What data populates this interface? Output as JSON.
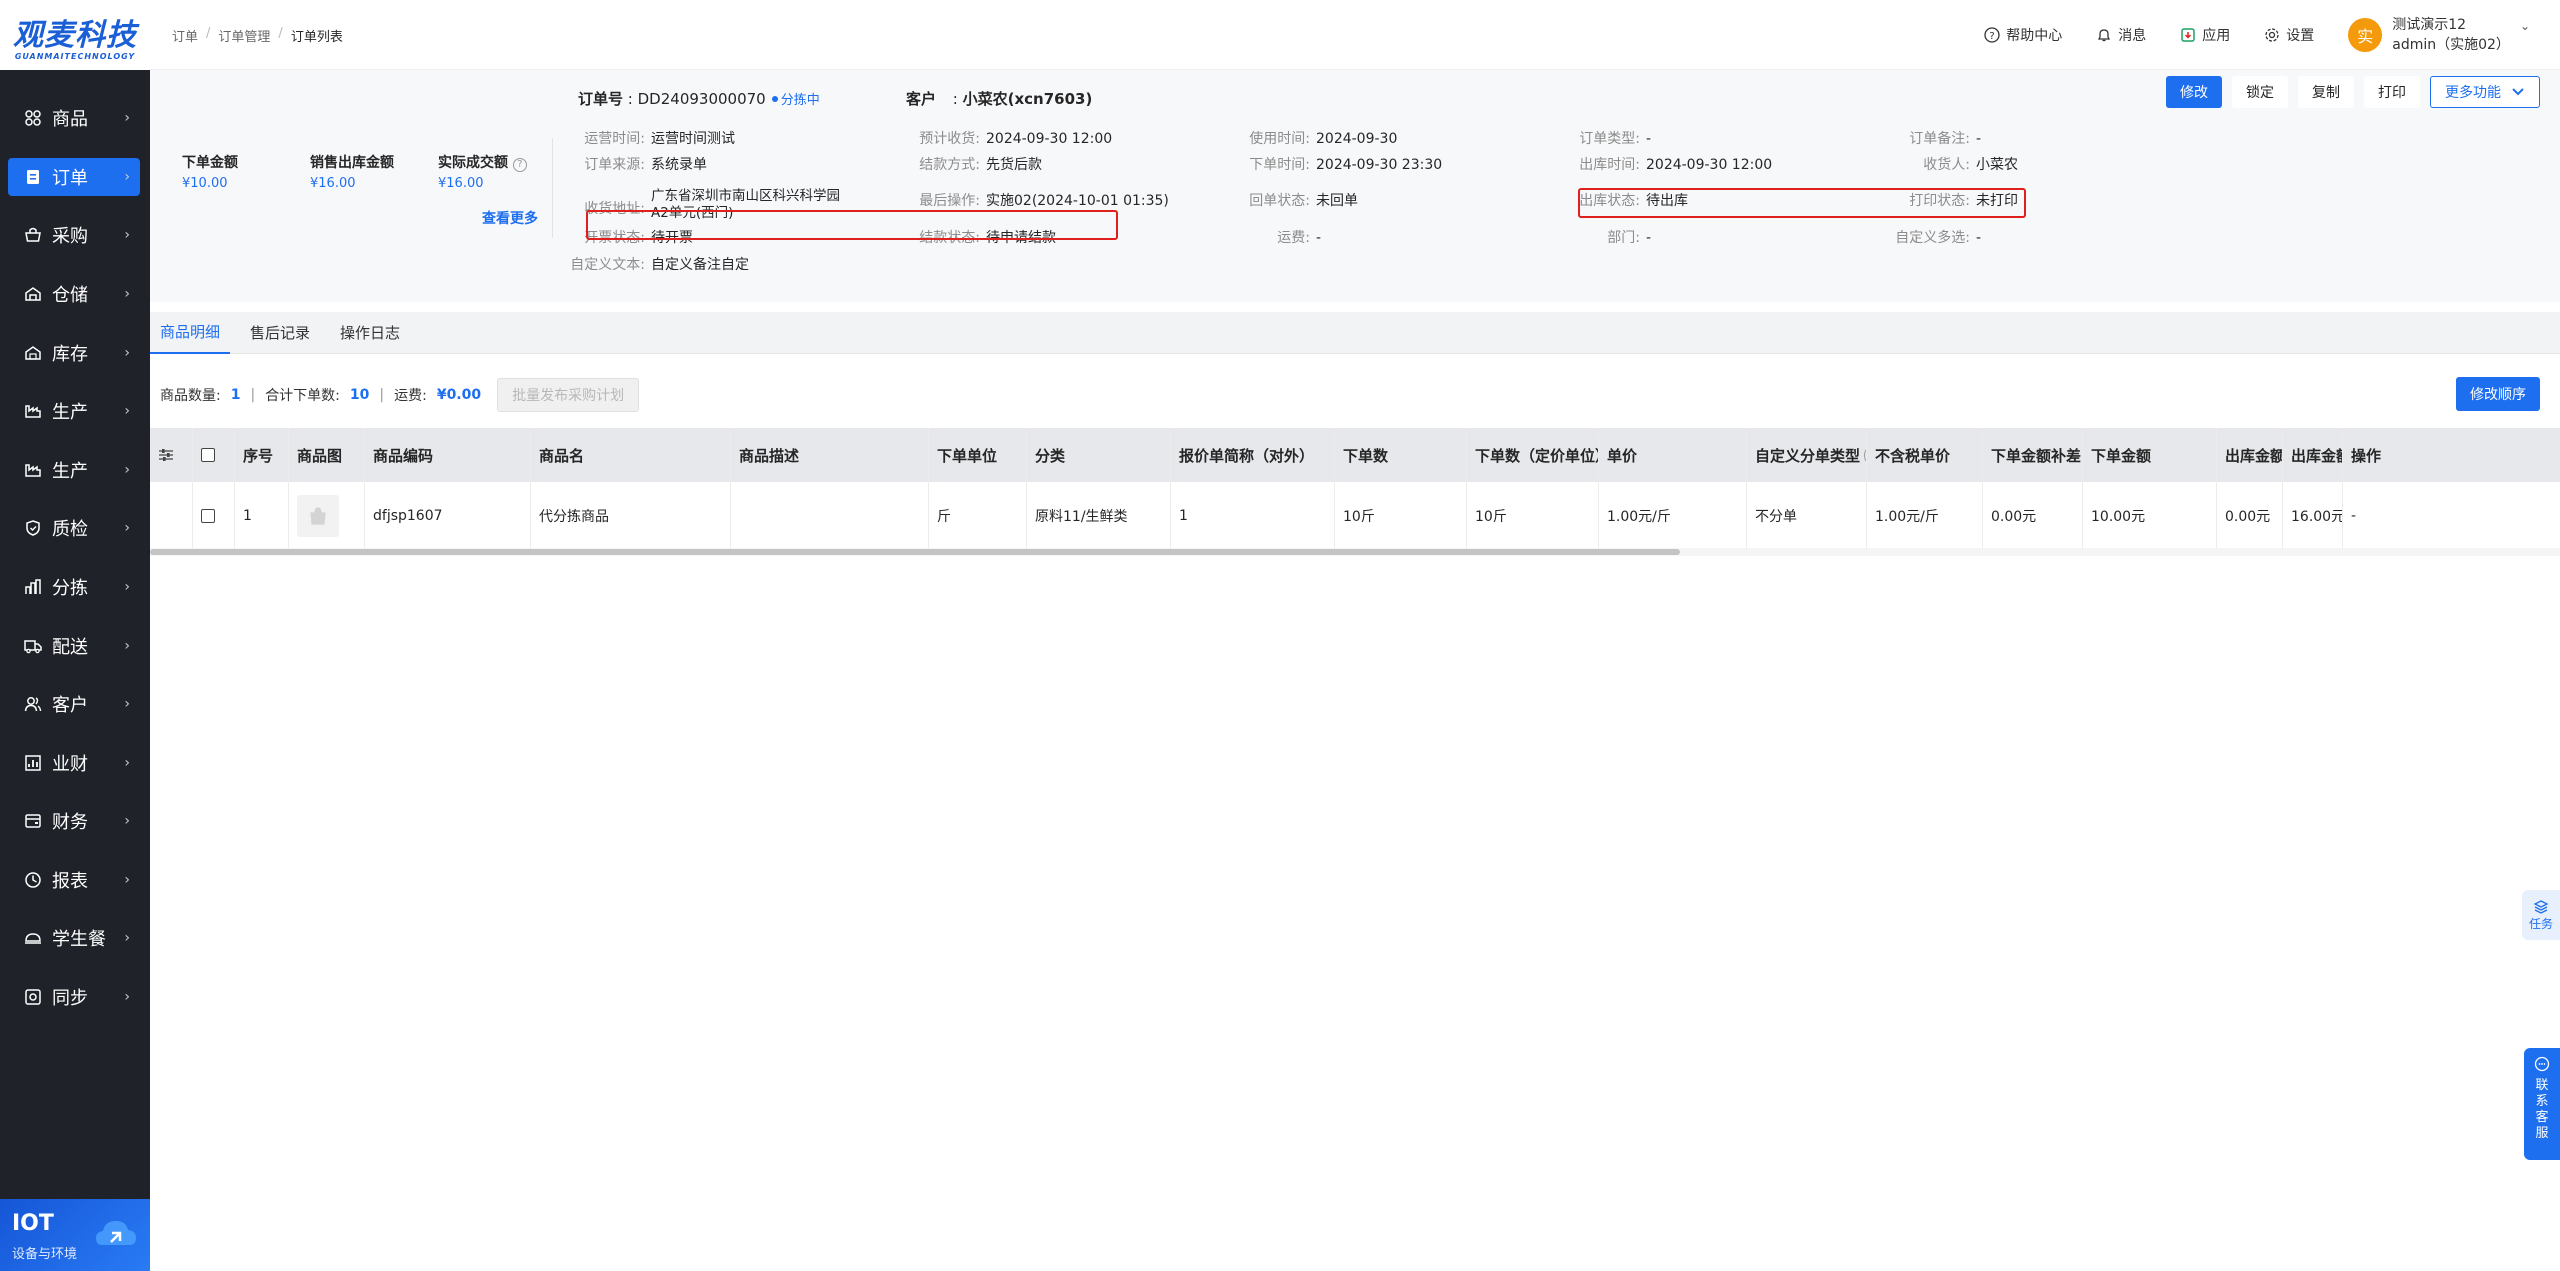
{
  "logo": {
    "name_cn": "观麦科技",
    "name_en": "GUANMAITECHNOLOGY"
  },
  "sidebar": {
    "items": [
      {
        "label": "商品",
        "icon": "grid-icon",
        "active": false
      },
      {
        "label": "订单",
        "icon": "order-icon",
        "active": true
      },
      {
        "label": "采购",
        "icon": "purchase-icon",
        "active": false
      },
      {
        "label": "仓储",
        "icon": "warehouse-icon",
        "active": false
      },
      {
        "label": "库存",
        "icon": "inventory-icon",
        "active": false
      },
      {
        "label": "生产",
        "icon": "factory-icon",
        "active": false
      },
      {
        "label": "生产",
        "icon": "factory-icon",
        "active": false
      },
      {
        "label": "质检",
        "icon": "shield-icon",
        "active": false
      },
      {
        "label": "分拣",
        "icon": "sorting-icon",
        "active": false
      },
      {
        "label": "配送",
        "icon": "truck-icon",
        "active": false
      },
      {
        "label": "客户",
        "icon": "customer-icon",
        "active": false
      },
      {
        "label": "业财",
        "icon": "chart-icon",
        "active": false
      },
      {
        "label": "财务",
        "icon": "finance-icon",
        "active": false
      },
      {
        "label": "报表",
        "icon": "report-icon",
        "active": false
      },
      {
        "label": "学生餐",
        "icon": "meal-icon",
        "active": false
      },
      {
        "label": "同步",
        "icon": "sync-icon",
        "active": false
      }
    ],
    "iot": {
      "title": "IOT",
      "subtitle": "设备与环境"
    }
  },
  "topbar": {
    "breadcrumb": [
      "订单",
      "订单管理",
      "订单列表"
    ],
    "help": "帮助中心",
    "messages": "消息",
    "apps": "应用",
    "settings": "设置",
    "user": {
      "avatar": "实",
      "name": "测试演示12",
      "account": "admin（实施02）"
    }
  },
  "summary": {
    "order_amount_label": "下单金额",
    "order_amount": "¥10.00",
    "sales_out_label": "销售出库金额",
    "sales_out": "¥16.00",
    "actual_label": "实际成交额",
    "actual": "¥16.00",
    "see_more": "查看更多"
  },
  "order": {
    "no_label": "订单号",
    "no": "DD24093000070",
    "status": "分拣中",
    "customer_label": "客户",
    "customer": "小菜农(xcn7603)",
    "fields": {
      "op_time": {
        "k": "运营时间:",
        "v": "运营时间测试"
      },
      "expect_recv": {
        "k": "预计收货:",
        "v": "2024-09-30 12:00"
      },
      "use_time": {
        "k": "使用时间:",
        "v": "2024-09-30"
      },
      "order_type": {
        "k": "订单类型:",
        "v": "-"
      },
      "order_remark": {
        "k": "订单备注:",
        "v": "-"
      },
      "source": {
        "k": "订单来源:",
        "v": "系统录单"
      },
      "settle_method": {
        "k": "结款方式:",
        "v": "先货后款"
      },
      "order_time": {
        "k": "下单时间:",
        "v": "2024-09-30 23:30"
      },
      "out_time": {
        "k": "出库时间:",
        "v": "2024-09-30 12:00"
      },
      "receiver": {
        "k": "收货人:",
        "v": "小菜农"
      },
      "address": {
        "k": "收货地址:",
        "v": "广东省深圳市南山区科兴科学园",
        "v2": "A2单元(西门)"
      },
      "last_op": {
        "k": "最后操作:",
        "v": "实施02(2024-10-01 01:35)"
      },
      "receipt_status": {
        "k": "回单状态:",
        "v": "未回单"
      },
      "out_status": {
        "k": "出库状态:",
        "v": "待出库"
      },
      "print_status": {
        "k": "打印状态:",
        "v": "未打印"
      },
      "invoice_status": {
        "k": "开票状态:",
        "v": "待开票"
      },
      "settle_status": {
        "k": "结款状态:",
        "v": "待申请结款"
      },
      "freight": {
        "k": "运费:",
        "v": "-"
      },
      "dept": {
        "k": "部门:",
        "v": "-"
      },
      "custom_multi": {
        "k": "自定义多选:",
        "v": "-"
      },
      "custom_text": {
        "k": "自定义文本:",
        "v": "自定义备注自定"
      }
    }
  },
  "actions": {
    "edit": "修改",
    "lock": "锁定",
    "copy": "复制",
    "print": "打印",
    "more": "更多功能"
  },
  "tabs": [
    "商品明细",
    "售后记录",
    "操作日志"
  ],
  "detail": {
    "count_label": "商品数量:",
    "count": "1",
    "total_label": "合计下单数:",
    "total": "10",
    "freight_label": "运费:",
    "freight": "¥0.00",
    "batch_btn": "批量发布采购计划",
    "reorder_btn": "修改顺序"
  },
  "table": {
    "columns": [
      "序号",
      "商品图",
      "商品编码",
      "商品名",
      "商品描述",
      "下单单位",
      "分类",
      "报价单简称（对外）",
      "下单数",
      "下单数（定价单位）",
      "单价",
      "自定义分单类型",
      "不含税单价",
      "下单金额补差",
      "下单金额",
      "出库金额补差",
      "出库金额",
      "操作"
    ],
    "rows": [
      [
        "1",
        "",
        "dfjsp1607",
        "代分拣商品",
        "",
        "斤",
        "原料11/生鲜类",
        "1",
        "10斤",
        "10斤",
        "1.00元/斤",
        "不分单",
        "1.00元/斤",
        "0.00元",
        "10.00元",
        "0.00元",
        "16.00元",
        "-"
      ]
    ]
  },
  "float": {
    "task": "任务",
    "contact": [
      "联",
      "系",
      "客",
      "服"
    ]
  }
}
